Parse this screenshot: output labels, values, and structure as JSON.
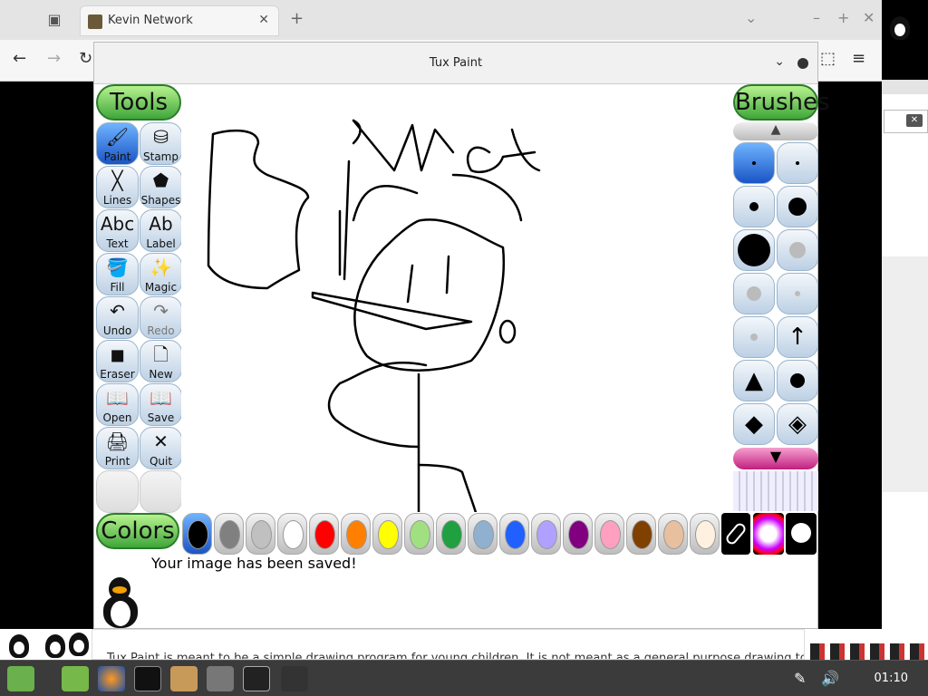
{
  "browser": {
    "tab_title": "Kevin Network",
    "tab_close": "✕",
    "new_tab": "+",
    "tab_list": "▣",
    "window_controls": [
      "⌄",
      "–",
      "+",
      "✕"
    ],
    "nav": {
      "back": "←",
      "forward": "→",
      "reload": "↻",
      "extensions": "⬚",
      "menu": "≡"
    }
  },
  "tuxpaint": {
    "window_title": "Tux Paint",
    "tools_header": "Tools",
    "brushes_header": "Brushes",
    "colors_header": "Colors",
    "tools": [
      {
        "label": "Paint",
        "icon": "🖌",
        "name": "paint"
      },
      {
        "label": "Stamp",
        "icon": "⛁",
        "name": "stamp"
      },
      {
        "label": "Lines",
        "icon": "╳",
        "name": "lines"
      },
      {
        "label": "Shapes",
        "icon": "⬟",
        "name": "shapes"
      },
      {
        "label": "Text",
        "icon": "Abc",
        "name": "text"
      },
      {
        "label": "Label",
        "icon": "Ab",
        "name": "label"
      },
      {
        "label": "Fill",
        "icon": "🪣",
        "name": "fill"
      },
      {
        "label": "Magic",
        "icon": "✨",
        "name": "magic"
      },
      {
        "label": "Undo",
        "icon": "↶",
        "name": "undo"
      },
      {
        "label": "Redo",
        "icon": "↷",
        "name": "redo"
      },
      {
        "label": "Eraser",
        "icon": "◼",
        "name": "eraser"
      },
      {
        "label": "New",
        "icon": "🗋",
        "name": "new"
      },
      {
        "label": "Open",
        "icon": "📖",
        "name": "open"
      },
      {
        "label": "Save",
        "icon": "📖",
        "name": "save"
      },
      {
        "label": "Print",
        "icon": "🖨",
        "name": "print"
      },
      {
        "label": "Quit",
        "icon": "✕",
        "name": "quit"
      }
    ],
    "colors": [
      "#000000",
      "#808080",
      "#c0c0c0",
      "#ffffff",
      "#ff0000",
      "#ff8000",
      "#ffff00",
      "#a0e080",
      "#20a040",
      "#90b0d0",
      "#2060ff",
      "#b0a0ff",
      "#800080",
      "#ffa0c0",
      "#804000",
      "#e8c0a0",
      "#fff0e0"
    ],
    "status_message": "Your image has been saved!"
  },
  "page_text": "Tux Paint is meant to be a simple drawing program for young children. It is not meant as a general purpose drawing tool. It IS",
  "taskbar": {
    "clock": "01:10"
  }
}
